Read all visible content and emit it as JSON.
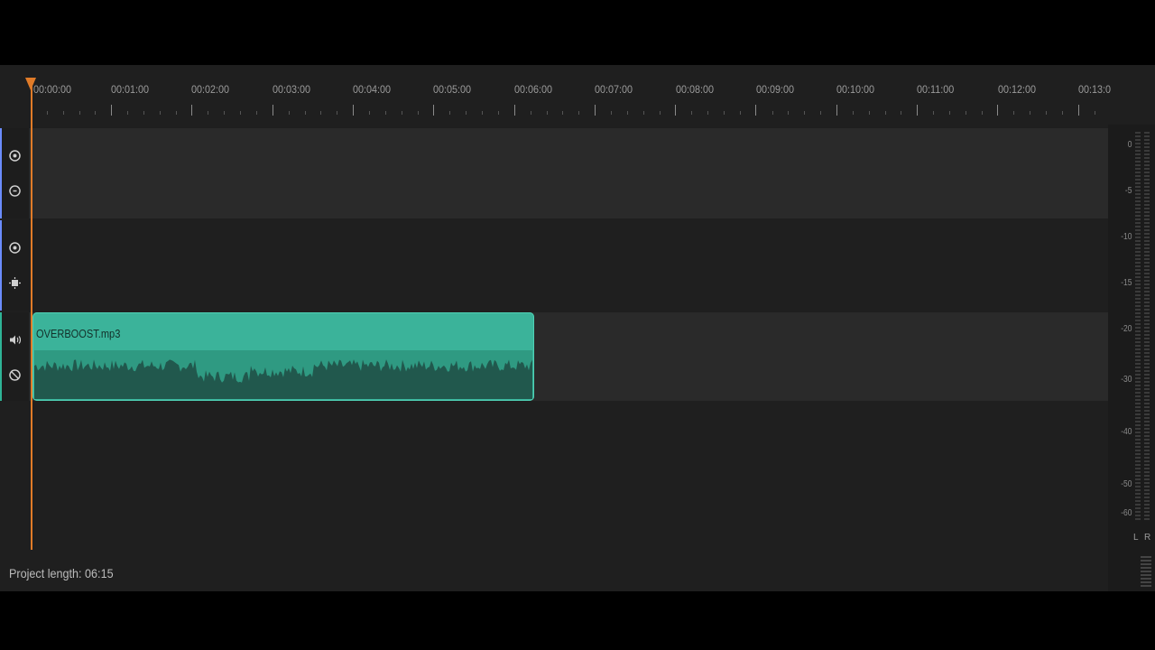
{
  "ruler": {
    "labels": [
      "00:00:00",
      "00:01:00",
      "00:02:00",
      "00:03:00",
      "00:04:00",
      "00:05:00",
      "00:06:00",
      "00:07:00",
      "00:08:00",
      "00:09:00",
      "00:10:00",
      "00:11:00",
      "00:12:00",
      "00:13:0"
    ]
  },
  "clip": {
    "name": "OVERBOOST.mp3",
    "color": "#3bb39a"
  },
  "meter": {
    "scale": [
      "0",
      "-5",
      "-10",
      "-15",
      "-20",
      "-30",
      "-40",
      "-50",
      "-60"
    ],
    "left": "L",
    "right": "R"
  },
  "status": {
    "project_length": "Project length: 06:15"
  },
  "colors": {
    "playhead": "#e07b28",
    "accent_video": "#6b8cff",
    "accent_audio": "#2fb496"
  }
}
